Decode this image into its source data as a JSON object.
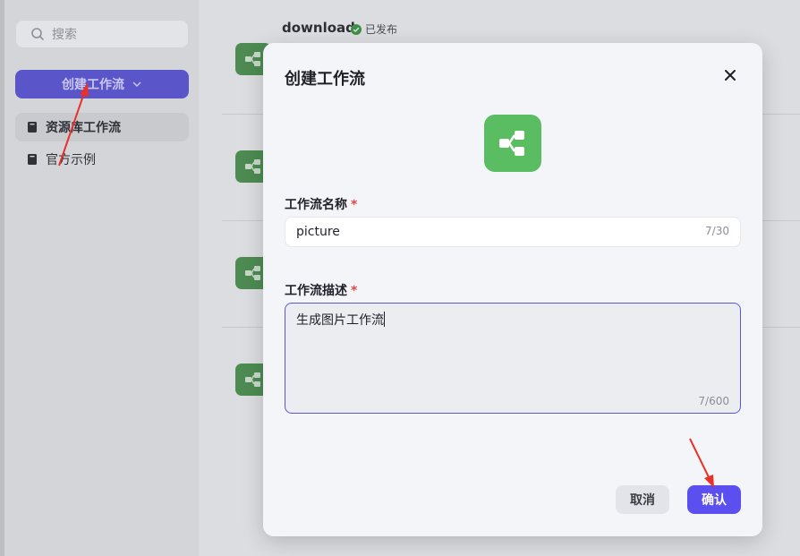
{
  "sidebar": {
    "search_placeholder": "搜索",
    "create_button_label": "创建工作流",
    "nav_items": [
      {
        "label": "资源库工作流"
      },
      {
        "label": "官方示例"
      }
    ]
  },
  "list": {
    "first_item_title": "download",
    "first_item_status": "已发布"
  },
  "dialog": {
    "title": "创建工作流",
    "name_label": "工作流名称",
    "name_value": "picture",
    "name_counter": "7/30",
    "desc_label": "工作流描述",
    "desc_value": "生成图片工作流",
    "desc_counter": "7/600",
    "required_mark": "*",
    "cancel_label": "取消",
    "confirm_label": "确认"
  },
  "colors": {
    "primary": "#5b4ff0",
    "app_icon": "#5bbd62",
    "required": "#e54545",
    "annotation_arrow": "#e8312a"
  },
  "icons": {
    "search": "search-icon",
    "chevron": "chevron-down-icon",
    "library": "book-icon",
    "workflow": "workflow-icon",
    "close": "close-icon",
    "published": "check-circle-icon"
  }
}
